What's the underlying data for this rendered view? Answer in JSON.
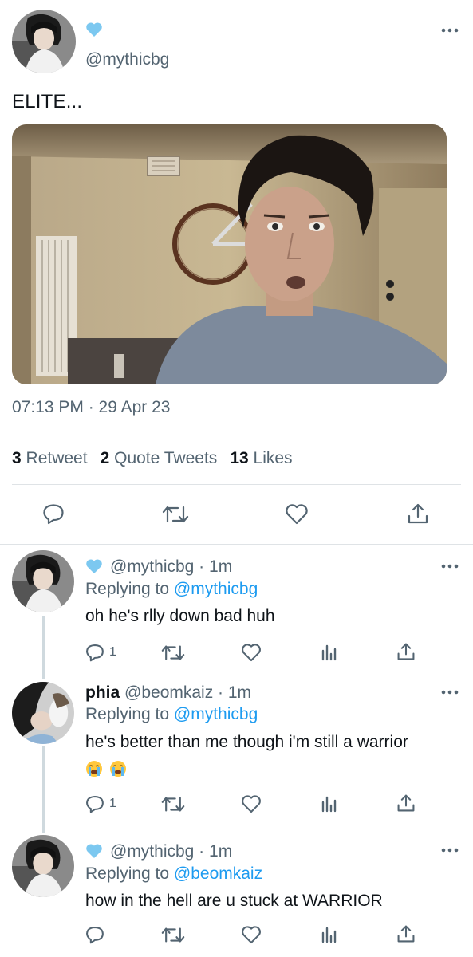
{
  "main_tweet": {
    "handle": "@mythicbg",
    "verified_icon": "blue-heart-icon",
    "text": "ELITE...",
    "timestamp": "07:13 PM · 29 Apr 23",
    "stats": {
      "retweets_count": "3",
      "retweets_label": "Retweet",
      "quotes_count": "2",
      "quotes_label": "Quote Tweets",
      "likes_count": "13",
      "likes_label": "Likes"
    },
    "actions": [
      "reply-icon",
      "retweet-icon",
      "like-icon",
      "share-icon"
    ]
  },
  "replies": [
    {
      "display_name": "",
      "handle_time": "@mythicbg · 1m",
      "replying_prefix": "Replying to",
      "replying_to": "@mythicbg",
      "text": "oh he's rlly down bad huh",
      "reply_count": "1"
    },
    {
      "display_name": "phia",
      "handle_time": "@beomkaiz · 1m",
      "replying_prefix": "Replying to",
      "replying_to": "@mythicbg",
      "text": "he's better than me though i'm still a warrior",
      "emojis": [
        "😭",
        "😭"
      ],
      "reply_count": "1"
    },
    {
      "display_name": "",
      "handle_time": "@mythicbg · 1m",
      "replying_prefix": "Replying to",
      "replying_to": "@beomkaiz",
      "text": "how in the hell are u stuck at WARRIOR",
      "reply_count": ""
    }
  ],
  "colors": {
    "link_blue": "#1d9bf0",
    "secondary_text": "#536471",
    "heart_blue": "#7cc8f0"
  }
}
